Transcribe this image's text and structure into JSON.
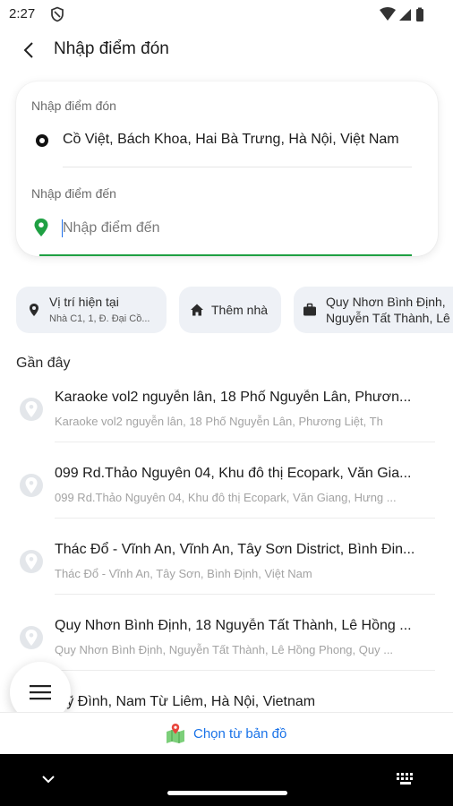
{
  "status": {
    "time": "2:27"
  },
  "header": {
    "title": "Nhập điểm đón"
  },
  "pickup": {
    "label": "Nhập điểm đón",
    "value": "Cồ Việt, Bách Khoa, Hai Bà Trưng, Hà Nội, Việt Nam"
  },
  "destination": {
    "label": "Nhập điểm đến",
    "placeholder": "Nhập điểm đến",
    "accent": "#1fa043"
  },
  "chips": {
    "current": {
      "title": "Vị trí hiện tại",
      "subtitle": "Nhà C1, 1, Đ. Đại Cồ..."
    },
    "home": {
      "label": "Thêm nhà"
    },
    "saved": {
      "line1": "Quy Nhơn Bình Định,",
      "line2": "Nguyễn Tất Thành, Lê"
    }
  },
  "recent": {
    "title": "Gần đây",
    "items": [
      {
        "main": "Karaoke vol2 nguyễn lân, 18 Phố Nguyễn Lân, Phươn...",
        "sub": "Karaoke vol2 nguyễn lân, 18 Phố Nguyễn Lân, Phương Liệt, Th"
      },
      {
        "main": "099 Rd.Thảo Nguyên 04, Khu đô thị Ecopark, Văn Gia...",
        "sub": "099 Rd.Thảo Nguyên 04, Khu đô thị Ecopark, Văn Giang, Hưng ..."
      },
      {
        "main": "Thác Đổ - Vĩnh An, Vĩnh An, Tây Sơn District, Bình Đin...",
        "sub": "Thác Đổ - Vĩnh An, Tây Sơn, Bình Định, Việt Nam"
      },
      {
        "main": "Quy Nhơn Bình Định, 18 Nguyễn Tất Thành, Lê Hồng ...",
        "sub": "Quy Nhơn Bình Định, Nguyễn Tất Thành, Lê Hồng Phong, Quy ..."
      },
      {
        "main": "Mỹ Đình, Nam Từ Liêm, Hà Nội, Vietnam",
        "sub": ""
      }
    ]
  },
  "map_button": {
    "label": "Chọn từ bản đồ"
  }
}
